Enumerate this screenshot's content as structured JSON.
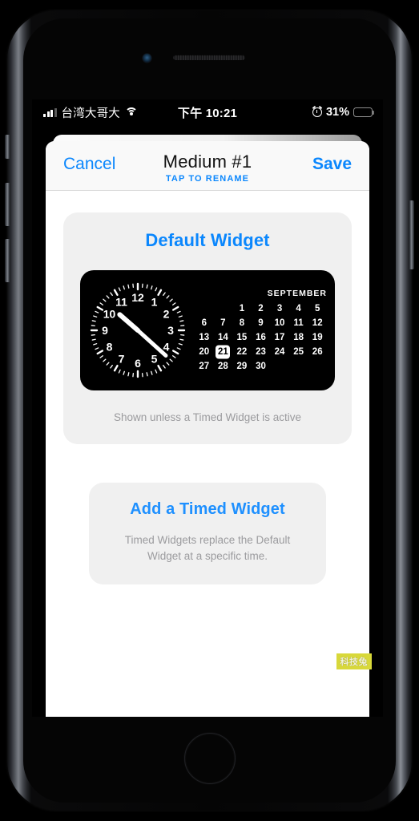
{
  "status_bar": {
    "carrier": "台湾大哥大",
    "time": "下午 10:21",
    "battery_percent": "31%",
    "signal_icon": "signal-bars-icon",
    "wifi_icon": "wifi-icon",
    "alarm_icon": "alarm-clock-icon",
    "battery_icon": "battery-icon"
  },
  "navbar": {
    "cancel_label": "Cancel",
    "title": "Medium #1",
    "subtitle": "TAP TO RENAME",
    "save_label": "Save"
  },
  "default_widget_card": {
    "title": "Default Widget",
    "note": "Shown unless a Timed Widget is active"
  },
  "widget_preview": {
    "clock": {
      "hour_hand_value": 10,
      "minute_hand_value": 22,
      "face_color": "#000000",
      "hand_color": "#ffffff",
      "numerals": [
        "12",
        "1",
        "2",
        "3",
        "4",
        "5",
        "6",
        "7",
        "8",
        "9",
        "10",
        "11"
      ]
    },
    "calendar": {
      "month": "SEPTEMBER",
      "today": "21",
      "weeks": [
        [
          "",
          "",
          "1",
          "2",
          "3",
          "4",
          "5"
        ],
        [
          "6",
          "7",
          "8",
          "9",
          "10",
          "11",
          "12"
        ],
        [
          "13",
          "14",
          "15",
          "16",
          "17",
          "18",
          "19"
        ],
        [
          "20",
          "21",
          "22",
          "23",
          "24",
          "25",
          "26"
        ],
        [
          "27",
          "28",
          "29",
          "30",
          "",
          "",
          ""
        ]
      ]
    }
  },
  "timed_widget_card": {
    "title": "Add a Timed Widget",
    "subtitle": "Timed Widgets replace the Default Widget at a specific time."
  },
  "watermark": {
    "text": "科技兔"
  },
  "colors": {
    "accent_blue": "#0b87fd",
    "card_gray": "#f0f0f0",
    "note_gray": "#9b9b9e",
    "navbar_gray": "#f9f9f9",
    "widget_black": "#000000",
    "watermark_bg": "#d8d83a"
  }
}
